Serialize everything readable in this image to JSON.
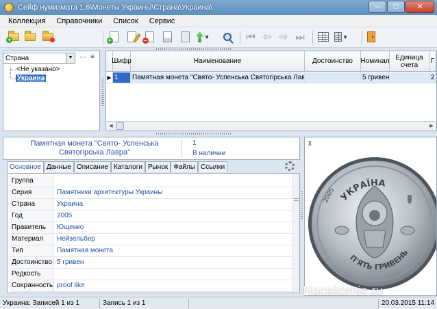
{
  "window": {
    "title": "Сейф нумизмата 1.6\\Монеты Украины\\Страна\\Украина\\",
    "minimize": "–",
    "maximize": "□",
    "close": "✕"
  },
  "menu": [
    "Коллекция",
    "Справочники",
    "Список",
    "Сервис"
  ],
  "tree": {
    "selector_value": "Страна",
    "nodes": [
      "<Не указано>",
      "Украина"
    ],
    "selected": "Украина"
  },
  "grid": {
    "columns": [
      "Шифр",
      "Наименование",
      "Достоинство",
      "Номинал",
      "Единица счета",
      "Г"
    ],
    "rows": [
      {
        "code": "1",
        "name": "Памятная монета \"Свято- Успенська Святогірська Лавра\"",
        "denomination": "",
        "nominal": "5 гривен",
        "unit": "",
        "extra": "2"
      }
    ]
  },
  "detail": {
    "title": "Памятная монета \"Свято- Успенська Святогірська Лавра\"",
    "number": "1",
    "status": "В наличии",
    "tabs": [
      "Основное",
      "Данные",
      "Описание",
      "Каталоги",
      "Рынок",
      "Файлы",
      "Ссылки"
    ],
    "active_tab": "Основное",
    "properties": [
      {
        "label": "Группа",
        "value": ""
      },
      {
        "label": "Серия",
        "value": "Памятники архитектуры Украины"
      },
      {
        "label": "Страна",
        "value": "Украина"
      },
      {
        "label": "Год",
        "value": "2005"
      },
      {
        "label": "Правитель",
        "value": "Ющенко"
      },
      {
        "label": "Материал",
        "value": "Нейзельбер"
      },
      {
        "label": "Тип",
        "value": "Памятная монета"
      },
      {
        "label": "Достоинство",
        "value": "5 гривен"
      },
      {
        "label": "Редкость",
        "value": ""
      },
      {
        "label": "Сохранность",
        "value": "proof like"
      }
    ]
  },
  "coin_image": {
    "inscription_top": "УКРАЇНА",
    "inscription_bottom": "П'ЯТЬ ГРИВЕНЬ",
    "year": "2005"
  },
  "status": {
    "records": "Украина: Записей 1 из 1",
    "position": "Запись 1 из 1",
    "datetime": "20.03.2015 11:14"
  },
  "watermark": "Nacekomie.ru",
  "icons": {
    "toolbar": [
      "new-collection-icon",
      "open-collection-icon",
      "folder-icon",
      "add-record-icon",
      "edit-record-icon",
      "delete-record-icon",
      "print-icon",
      "export-icon",
      "search-icon",
      "first-icon",
      "prev-icon",
      "next-icon",
      "last-icon",
      "grid-view-icon",
      "columns-icon",
      "exit-icon"
    ]
  },
  "colors": {
    "accent": "#2f6cc9",
    "value_text": "#2551a3",
    "titlebar": "#6d9bc8"
  }
}
